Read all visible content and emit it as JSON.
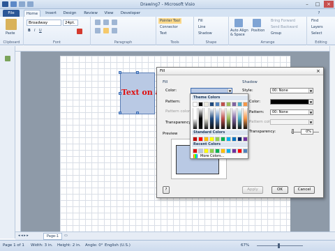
{
  "window": {
    "title": "Drawing7 - Microsoft Visio"
  },
  "tabs": [
    {
      "label": "File"
    },
    {
      "label": "Home"
    },
    {
      "label": "Insert"
    },
    {
      "label": "Design"
    },
    {
      "label": "Review"
    },
    {
      "label": "View"
    },
    {
      "label": "Developer"
    }
  ],
  "ribbon": {
    "clipboard": {
      "group": "Clipboard",
      "paste": "Paste"
    },
    "font": {
      "group": "Font",
      "family": "Broadway",
      "size": "24pt."
    },
    "paragraph": {
      "group": "Paragraph"
    },
    "tools": {
      "group": "Tools",
      "pointer": "Pointer Tool",
      "connector": "Connector",
      "text": "Text"
    },
    "shape": {
      "group": "Shape",
      "fill": "Fill",
      "line": "Line",
      "shadow": "Shadow"
    },
    "arrange": {
      "group": "Arrange",
      "auto_align": "Auto Align & Space",
      "position": "Position",
      "bring_forward": "Bring Forward",
      "send_backward": "Send Backward",
      "group_btn": "Group"
    },
    "editing": {
      "group": "Editing",
      "find": "Find",
      "layers": "Layers",
      "select": "Select"
    }
  },
  "shape_text": "Text on a",
  "page_tab": "Page-1",
  "status": {
    "page": "Page 1 of 1",
    "width": "Width: 3 in.",
    "height": "Height: 2 in.",
    "angle": "Angle: 0°",
    "language": "English (U.S.)",
    "zoom": "67%"
  },
  "dialog": {
    "title": "Fill",
    "fill_section": "Fill",
    "shadow_section": "Shadow",
    "color_label": "Color:",
    "pattern_label": "Pattern:",
    "pattern_color_label": "Pattern color:",
    "transparency_label": "Transparency:",
    "shadow_style_label": "Style:",
    "shadow_style_value": "00: None",
    "shadow_color_label": "Color:",
    "shadow_pattern_label": "Pattern:",
    "shadow_pattern_value": "00: None",
    "shadow_pattern_color_label": "Pattern color:",
    "shadow_transparency_label": "Transparency:",
    "shadow_transparency_value": "0%",
    "preview_label": "Preview",
    "apply": "Apply",
    "ok": "OK",
    "cancel": "Cancel"
  },
  "palette": {
    "theme_header": "Theme Colors",
    "standard_header": "Standard Colors",
    "recent_header": "Recent Colors",
    "more_colors": "More Colors...",
    "theme_top": [
      "#ffffff",
      "#000000",
      "#eeece1",
      "#1f497d",
      "#4f81bd",
      "#c0504d",
      "#9bbb59",
      "#8064a2",
      "#4bacc6",
      "#f79646"
    ],
    "standard": [
      "#c00000",
      "#ff0000",
      "#ffc000",
      "#ffff00",
      "#92d050",
      "#00b050",
      "#00b0f0",
      "#0070c0",
      "#002060",
      "#7030a0"
    ],
    "recent": [
      "#e01010",
      "#b9c9e4",
      "#ffff00",
      "#92d050",
      "#00b050",
      "#ffc000",
      "#00b0f0",
      "#7030a0",
      "#ff0000",
      "#4f81bd"
    ]
  }
}
